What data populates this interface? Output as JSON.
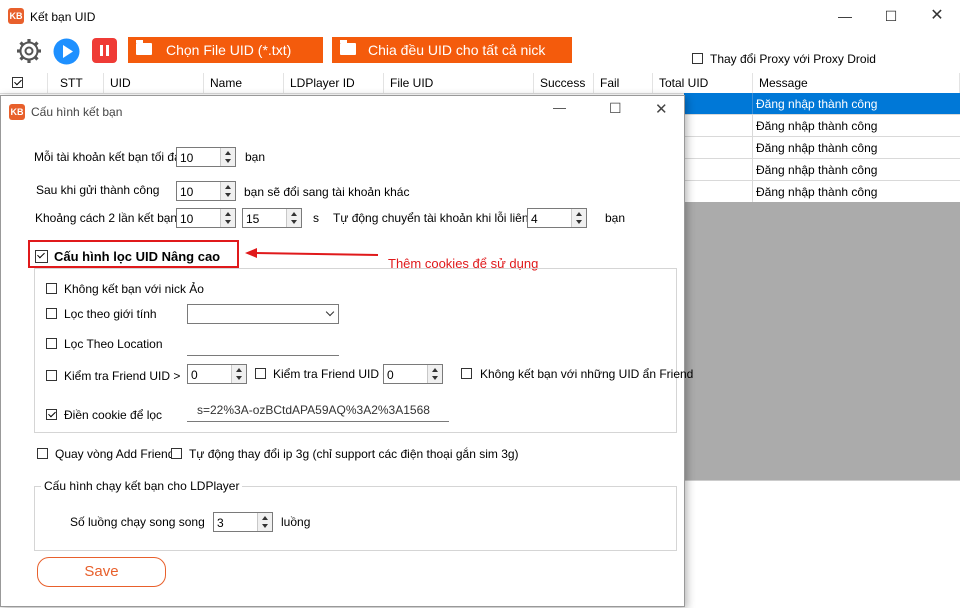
{
  "main_window": {
    "title": "Kết bạn UID",
    "app_icon_text": "KB",
    "buttons": {
      "choose_file": "Chọn File UID (*.txt)",
      "split_uid": "Chia đều UID cho tất cả nick"
    },
    "proxy_checkbox": "Thay đổi Proxy với Proxy Droid",
    "table": {
      "columns": [
        "STT",
        "UID",
        "Name",
        "LDPlayer ID",
        "File UID",
        "Success",
        "Fail",
        "Total UID",
        "Message"
      ],
      "messages": [
        "Đăng nhập thành công",
        "Đăng nhập thành công",
        "Đăng nhập thành công",
        "Đăng nhập thành công",
        "Đăng nhập thành công"
      ]
    }
  },
  "dialog": {
    "title": "Cấu hình kết bạn",
    "max_friends": {
      "label": "Mỗi tài khoản kết bạn tối đa",
      "value": "10",
      "suffix": "bạn"
    },
    "after_success": {
      "label": "Sau khi gửi thành công",
      "value": "10",
      "suffix": "bạn sẽ đổi sang tài khoản khác"
    },
    "interval": {
      "label": "Khoảng cách 2 lần kết bạn",
      "min": "10",
      "max": "15",
      "unit": "s"
    },
    "auto_switch": {
      "label": "Tự động chuyển tài khoản khi lỗi liên tục",
      "value": "4",
      "suffix": "bạn"
    },
    "advanced": {
      "label": "Cấu hình lọc UID Nâng cao",
      "checked": true,
      "annotation": "Thêm cookies để sử dụng",
      "no_fake": "Không kết bạn với nick Ảo",
      "gender_filter": "Lọc theo giới tính",
      "gender_value": "",
      "location_filter": "Lọc Theo Location",
      "location_value": "",
      "friend_gt": {
        "label": "Kiểm tra Friend UID >",
        "value": "0"
      },
      "friend_lt": {
        "label": "Kiểm tra Friend UID <",
        "value": "0"
      },
      "hidden_friend": "Không kết bạn với những UID ẩn Friend",
      "cookie": {
        "label": "Điền cookie để lọc",
        "checked": true,
        "value": "s=22%3A-ozBCtdAPA59AQ%3A2%3A1568"
      }
    },
    "loop_add": "Quay vòng Add Friend",
    "auto_ip": "Tự động thay đổi ip 3g (chỉ support các điện thoại gắn sim 3g)",
    "ld_group": {
      "title": "Cấu hình chạy kết bạn cho LDPlayer",
      "threads_label": "Số luồng chạy song song",
      "threads_value": "3",
      "threads_suffix": "luồng"
    },
    "save": "Save"
  },
  "colors": {
    "accent": "#f45b0c",
    "annotation": "#e0191b",
    "selected_row": "#0078d7",
    "grid_bg": "#ababab"
  },
  "icons": [
    "gear-icon",
    "play-icon",
    "pause-icon",
    "folder-icon",
    "minimize-icon",
    "maximize-icon",
    "close-icon"
  ]
}
